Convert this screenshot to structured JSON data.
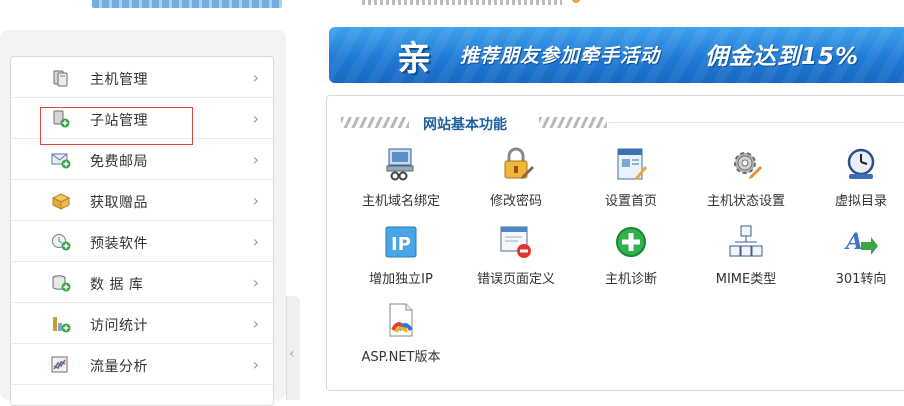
{
  "sidebar": {
    "items": [
      {
        "label": "主机管理",
        "icon": "server-icon"
      },
      {
        "label": "子站管理",
        "icon": "subsite-server-icon"
      },
      {
        "label": "免费邮局",
        "icon": "mail-icon"
      },
      {
        "label": "获取赠品",
        "icon": "gift-box-icon"
      },
      {
        "label": "预装软件",
        "icon": "software-install-icon"
      },
      {
        "label": "数 据 库",
        "icon": "database-icon"
      },
      {
        "label": "访问统计",
        "icon": "statistics-icon"
      },
      {
        "label": "流量分析",
        "icon": "traffic-chart-icon"
      }
    ],
    "highlighted_item": "子站管理",
    "chevron": "›",
    "collapse_glyph": "‹"
  },
  "banner": {
    "badge": "亲",
    "message": "推荐朋友参加牵手活动",
    "message2": "佣金达到15%"
  },
  "panel": {
    "title": "网站基本功能",
    "functions": [
      {
        "label": "主机域名绑定",
        "icon": "domain-binding-icon"
      },
      {
        "label": "修改密码",
        "icon": "lock-icon"
      },
      {
        "label": "设置首页",
        "icon": "homepage-settings-icon"
      },
      {
        "label": "主机状态设置",
        "icon": "gear-icon"
      },
      {
        "label": "虚拟目录",
        "icon": "virtual-directory-icon"
      },
      {
        "label": "增加独立IP",
        "icon": "ip-icon"
      },
      {
        "label": "错误页面定义",
        "icon": "error-page-icon"
      },
      {
        "label": "主机诊断",
        "icon": "diagnose-plus-icon"
      },
      {
        "label": "MIME类型",
        "icon": "mime-tree-icon"
      },
      {
        "label": "301转向",
        "icon": "redirect-icon"
      },
      {
        "label": "ASP.NET版本",
        "icon": "aspnet-icon"
      }
    ]
  },
  "colors": {
    "banner_blue": "#1f7ad6",
    "panel_title": "#1c5fa3",
    "highlight_red": "#e0463f"
  }
}
